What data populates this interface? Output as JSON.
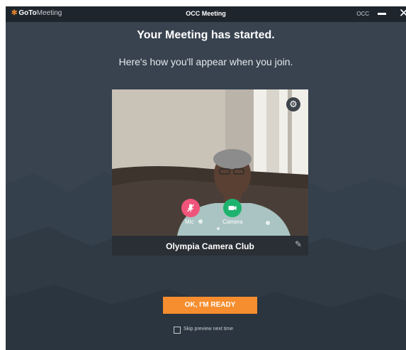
{
  "titlebar": {
    "logo_bold": "GoTo",
    "logo_light": "Meeting",
    "window_title": "OCC Meeting",
    "user_initials": "OCC"
  },
  "heading": "Your Meeting has started.",
  "subheading": "Here's how you'll appear when you join.",
  "preview": {
    "mic_label": "Mic",
    "camera_label": "Camera",
    "display_name": "Olympia Camera Club"
  },
  "actions": {
    "ready_button": "OK, I'M READY",
    "skip_preview_label": "Skip preview next time",
    "skip_preview_checked": false
  },
  "colors": {
    "accent_orange": "#f68d2e",
    "background": "#38434f",
    "titlebar": "#1e252d",
    "mic_muted": "#f0547a",
    "camera_on": "#1db36e"
  },
  "icons": [
    "gear-icon",
    "mic-off-icon",
    "video-camera-icon",
    "pencil-icon",
    "minimize-icon",
    "close-icon"
  ]
}
